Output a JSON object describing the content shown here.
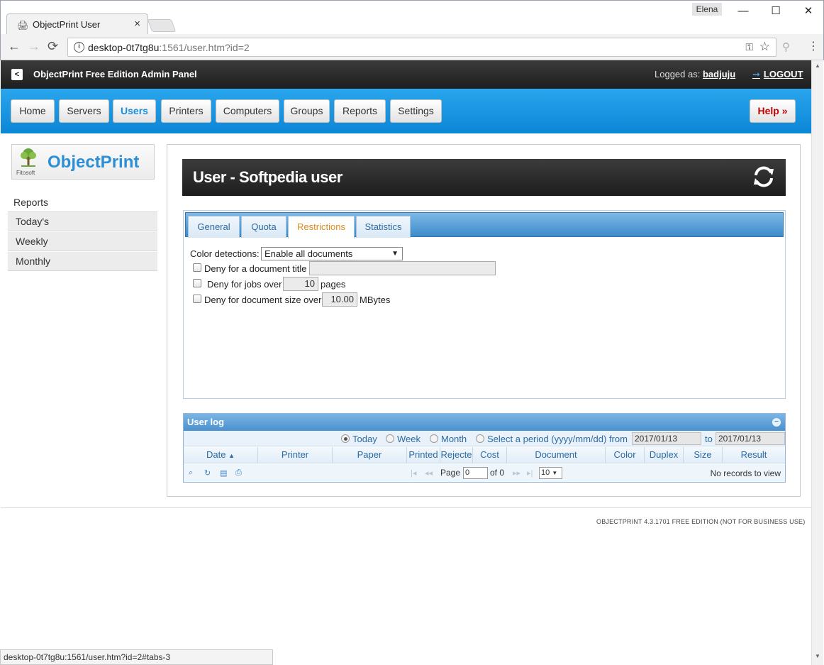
{
  "browser": {
    "tab_title": "ObjectPrint User",
    "tab_close": "×",
    "profile_name": "Elena",
    "window_min": "—",
    "window_max": "☐",
    "window_close": "✕",
    "url_host": "desktop-0t7tg8u",
    "url_rest": ":1561/user.htm?id=2",
    "status_url": "desktop-0t7tg8u:1561/user.htm?id=2#tabs-3",
    "icons": [
      "back-icon",
      "forward-icon",
      "reload-icon",
      "info-icon",
      "key-icon",
      "star-icon",
      "search-extension-icon",
      "menu-icon"
    ]
  },
  "topbar": {
    "title": "ObjectPrint Free Edition Admin Panel",
    "logged_as_label": "Logged as:",
    "username": "badjuju",
    "logout": "LOGOUT"
  },
  "nav": {
    "items": [
      "Home",
      "Servers",
      "Users",
      "Printers",
      "Computers",
      "Groups",
      "Reports",
      "Settings"
    ],
    "active": "Users",
    "help": "Help »"
  },
  "sidebar": {
    "logo_text": "ObjectPrint",
    "logo_sub": "Fitosoft",
    "heading": "Reports",
    "items": [
      "Today's",
      "Weekly",
      "Monthly"
    ]
  },
  "panel": {
    "title": "User - Softpedia user",
    "tabs": [
      "General",
      "Quota",
      "Restrictions",
      "Statistics"
    ],
    "active_tab": "Restrictions",
    "form": {
      "color_detection_label": "Color detections:",
      "color_detection_value": "Enable all documents",
      "deny_title_label": "Deny for a document title",
      "deny_title_value": "",
      "deny_jobs_label": "Deny for jobs over",
      "deny_jobs_value": "10",
      "deny_jobs_unit": "pages",
      "deny_size_label": "Deny for document size over",
      "deny_size_value": "10.00",
      "deny_size_unit": "MBytes"
    }
  },
  "user_log": {
    "caption": "User log",
    "filters": {
      "today": "Today",
      "week": "Week",
      "month": "Month",
      "period": "Select a period (yyyy/mm/dd) from",
      "to": "to",
      "from_date": "2017/01/13",
      "to_date": "2017/01/13",
      "selected": "Today"
    },
    "columns": [
      "Date",
      "Printer",
      "Paper",
      "Printed",
      "Rejecte",
      "Cost",
      "Document",
      "Color",
      "Duplex",
      "Size",
      "Result"
    ],
    "pager": {
      "page_label": "Page",
      "page_value": "0",
      "of_label": "of 0",
      "rows_value": "10",
      "empty_text": "No records to view"
    }
  },
  "footer": "OBJECTPRINT 4.3.1701  FREE EDITION (NOT FOR BUSINESS USE)",
  "colors": {
    "nav_blue": "#0a86d6",
    "topbar_dark": "#1e1e1e",
    "active_tab_orange": "#e08a1e",
    "help_red": "#c20000"
  }
}
